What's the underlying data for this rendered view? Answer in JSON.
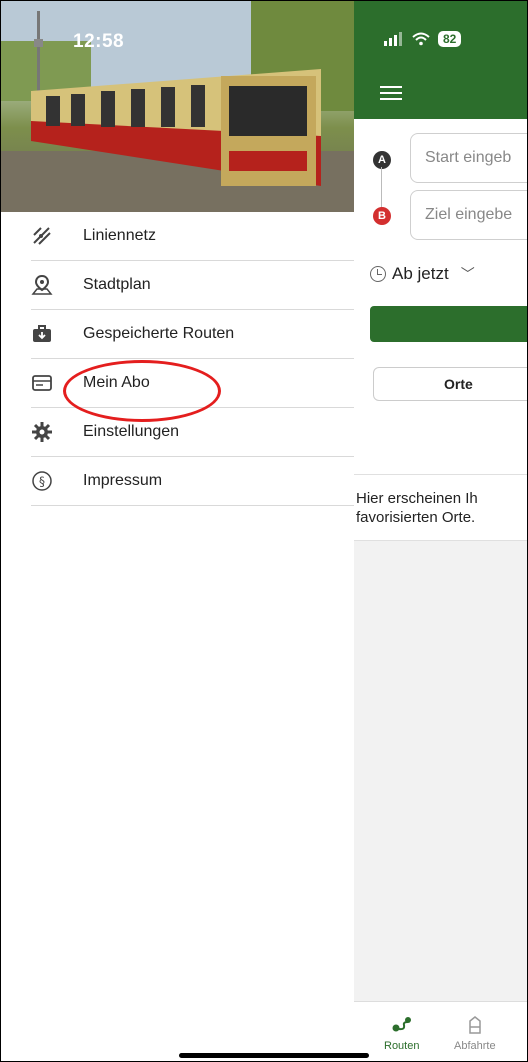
{
  "status": {
    "time": "12:58",
    "battery": "82"
  },
  "menu": {
    "items": [
      {
        "label": "Liniennetz",
        "icon": "network-map-icon"
      },
      {
        "label": "Stadtplan",
        "icon": "map-pin-icon"
      },
      {
        "label": "Gespeicherte Routen",
        "icon": "briefcase-icon"
      },
      {
        "label": "Mein Abo",
        "icon": "card-icon"
      },
      {
        "label": "Einstellungen",
        "icon": "gear-icon"
      },
      {
        "label": "Impressum",
        "icon": "paragraph-icon"
      }
    ]
  },
  "route_form": {
    "start_placeholder": "Start eingeb",
    "destination_placeholder": "Ziel eingebe",
    "pin_a": "A",
    "pin_b": "B",
    "time_selector": "Ab jetzt"
  },
  "places": {
    "tab_label": "Orte",
    "empty_text_line1": "Hier erscheinen Ih",
    "empty_text_line2": "favorisierten Orte."
  },
  "tabbar": {
    "routes_label": "Routen",
    "departures_label": "Abfahrte"
  },
  "colors": {
    "accent": "#2c6e2c",
    "pin_a": "#333333",
    "pin_b": "#d32f2f",
    "highlight_circle": "#e41e1e"
  }
}
